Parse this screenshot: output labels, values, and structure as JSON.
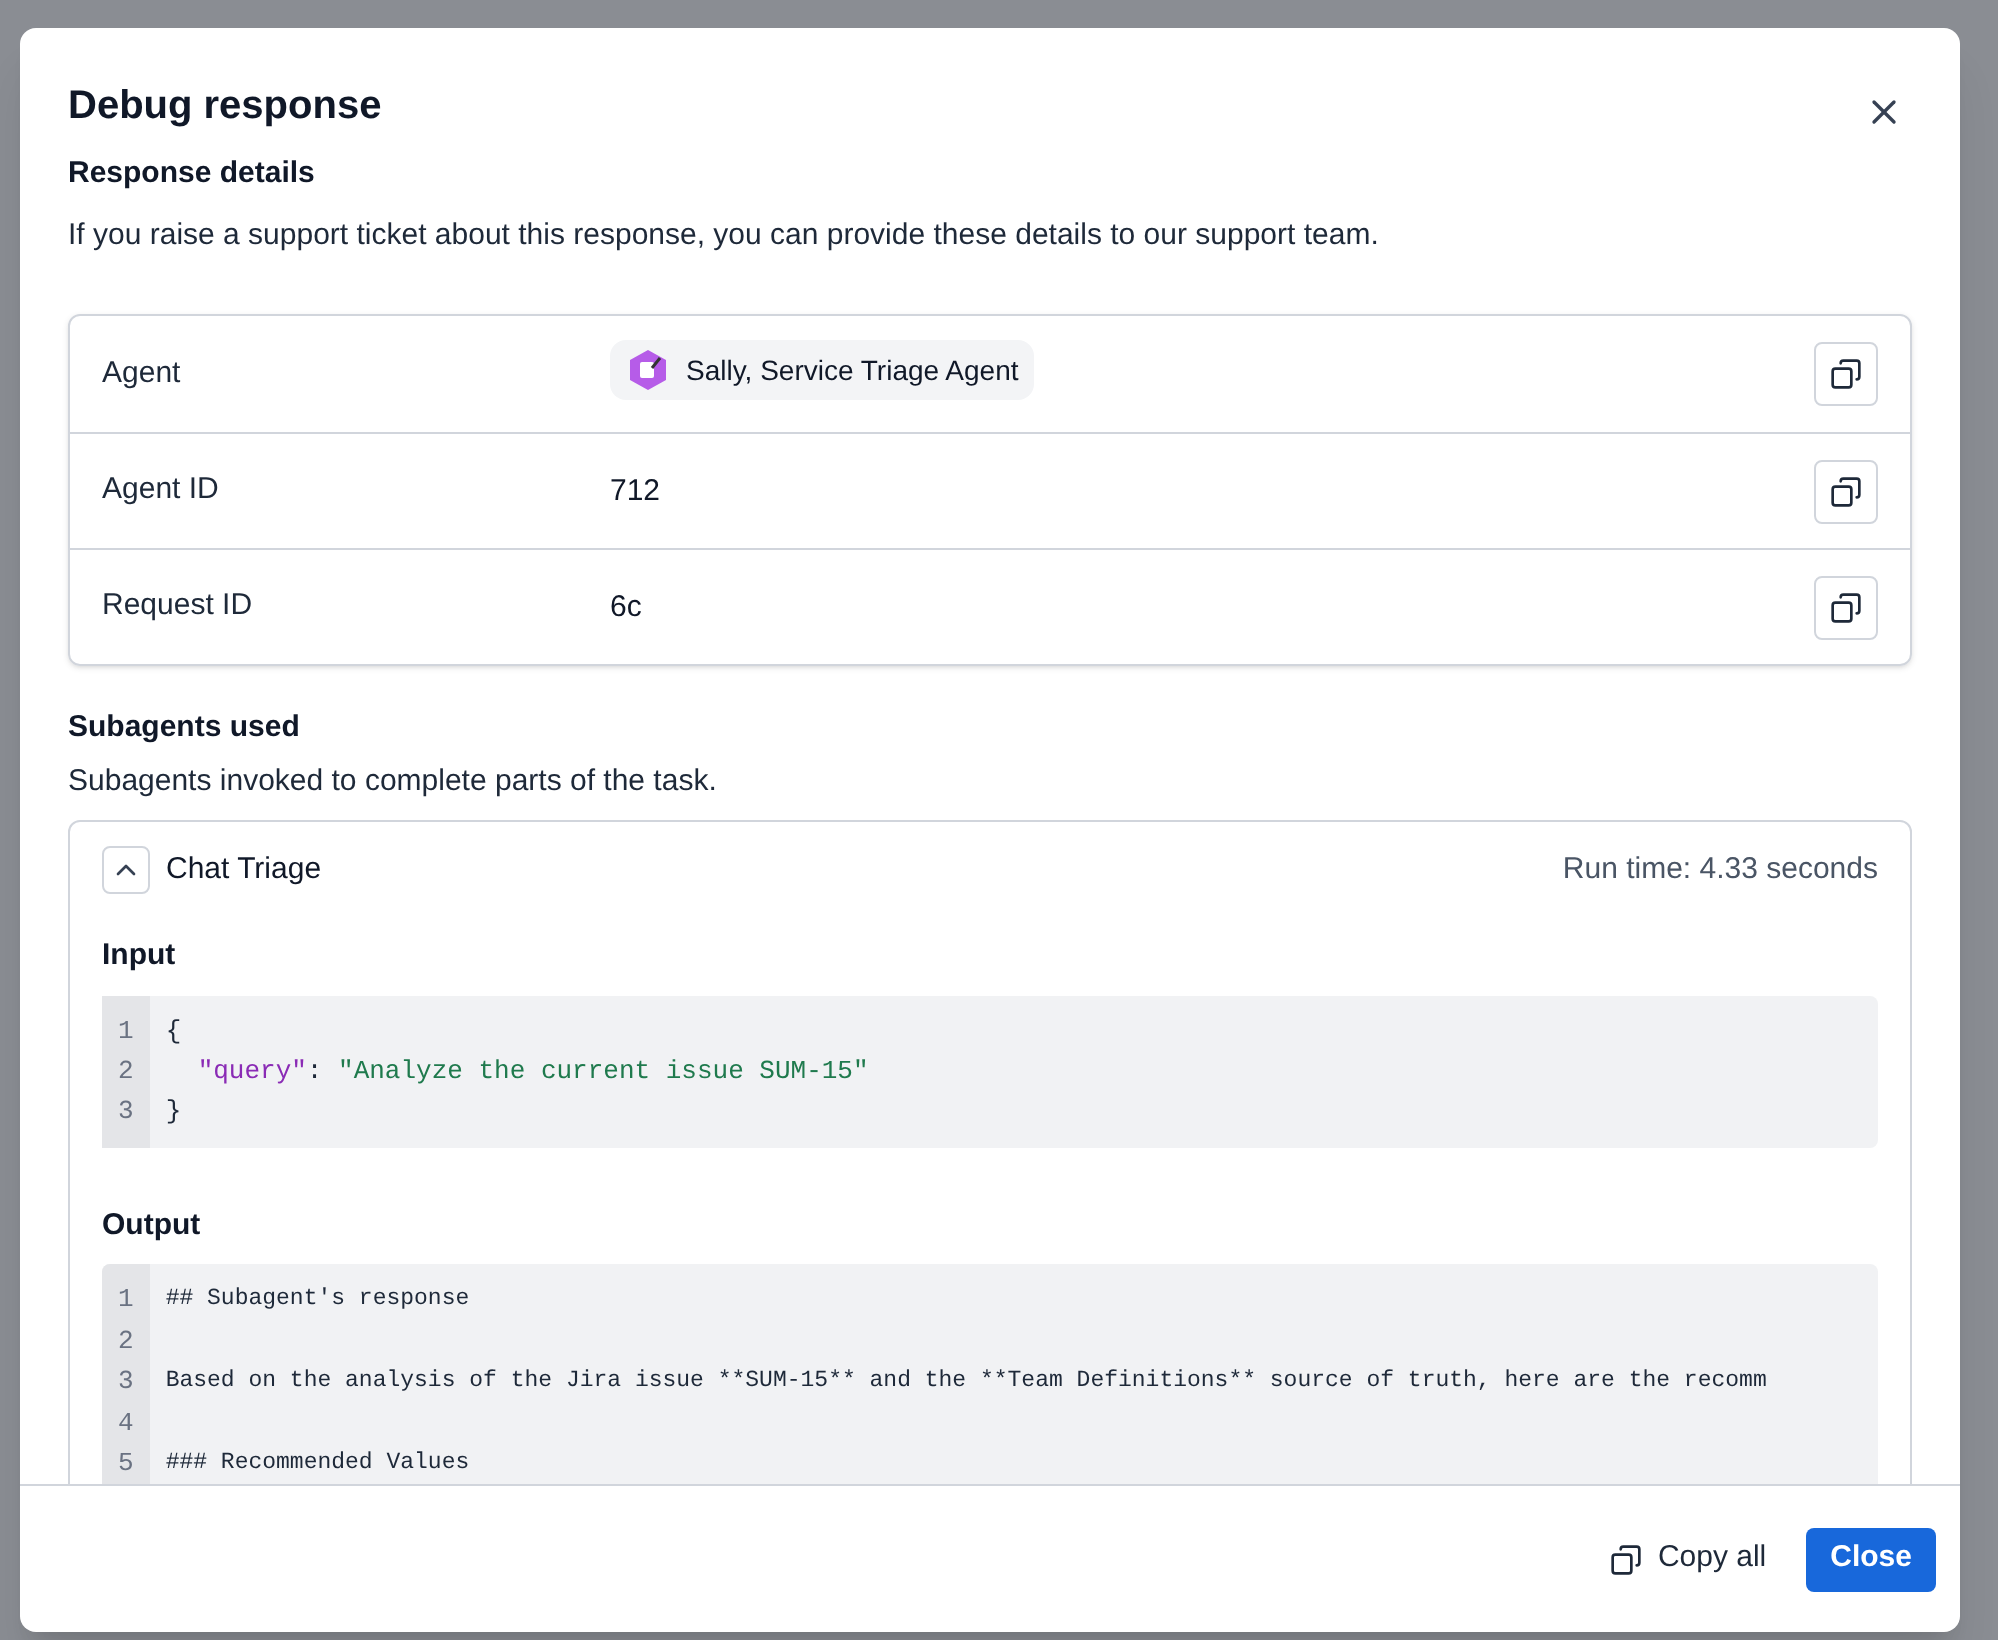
{
  "dialog": {
    "title": "Debug response",
    "section_title": "Response details",
    "section_description": "If you raise a support ticket about this response, you can provide these details to our support team.",
    "details": [
      {
        "label": "Agent",
        "kind": "agent",
        "value": "Sally, Service Triage Agent"
      },
      {
        "label": "Agent ID",
        "kind": "text",
        "value": "712"
      },
      {
        "label": "Request ID",
        "kind": "text",
        "value": "6c"
      }
    ],
    "subagents_title": "Subagents used",
    "subagents_description": "Subagents invoked to complete parts of the task.",
    "subagents": [
      {
        "name": "Chat Triage",
        "expanded": true,
        "run_time": "Run time: 4.33 seconds",
        "input_label": "Input",
        "input_lines": [
          {
            "number": "1",
            "parts": [
              {
                "kind": "plain",
                "text": "{"
              }
            ]
          },
          {
            "number": "2",
            "parts": [
              {
                "kind": "indent"
              },
              {
                "kind": "key",
                "text": "\"query\""
              },
              {
                "kind": "plain",
                "text": ": "
              },
              {
                "kind": "string",
                "text": "\"Analyze the current issue SUM-15\""
              }
            ]
          },
          {
            "number": "3",
            "parts": [
              {
                "kind": "plain",
                "text": "}"
              }
            ]
          }
        ],
        "output_label": "Output",
        "output_lines": [
          {
            "number": "1",
            "text": "## Subagent's response"
          },
          {
            "number": "2"
          },
          {
            "number": "3",
            "text": "Based on the analysis of the Jira issue **SUM-15** and the **Team Definitions** source of truth, here are the recomm"
          },
          {
            "number": "4"
          },
          {
            "number": "5",
            "text": "### Recommended Values"
          }
        ]
      }
    ],
    "footer": {
      "copy_all": "Copy all",
      "close": "Close"
    }
  }
}
